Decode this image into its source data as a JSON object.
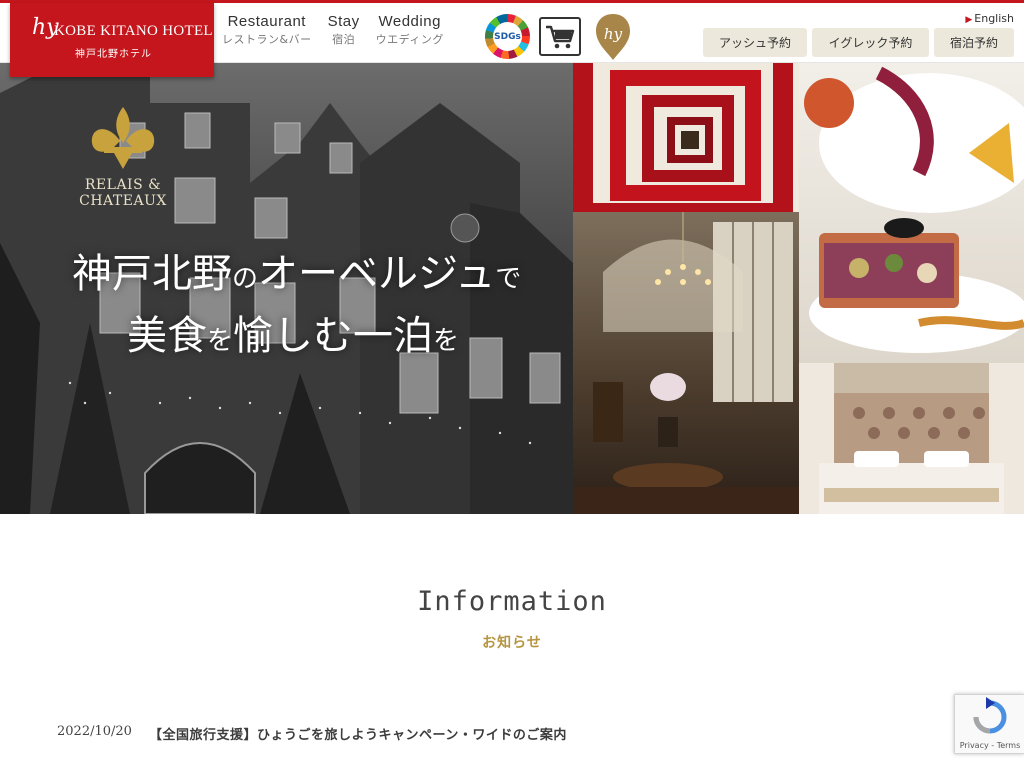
{
  "header": {
    "logo": {
      "mark": "hy",
      "name": "KOBE KITANO HOTEL",
      "sub": "神戸北野ホテル"
    },
    "nav": [
      {
        "en": "Restaurant",
        "ja": "レストラン&バー"
      },
      {
        "en": "Stay",
        "ja": "宿泊"
      },
      {
        "en": "Wedding",
        "ja": "ウエディング"
      }
    ],
    "sdgs_label": "SDGs",
    "lang_link": "English",
    "buttons": [
      {
        "label": "アッシュ予約"
      },
      {
        "label": "イグレック予約"
      },
      {
        "label": "宿泊予約"
      }
    ]
  },
  "hero": {
    "emblem_text_1": "RELAIS &",
    "emblem_text_2": "CHATEAUX",
    "copy_line1_a": "神戸北野",
    "copy_line1_b": "の",
    "copy_line1_c": "オーベルジュ",
    "copy_line1_d": "で",
    "copy_line2_a": "美食",
    "copy_line2_b": "を",
    "copy_line2_c": "愉しむ一泊",
    "copy_line2_d": "を"
  },
  "information": {
    "title": "Information",
    "subtitle": "お知らせ",
    "items": [
      {
        "date": "2022/10/20",
        "title": "【全国旅行支援】ひょうごを旅しようキャンペーン・ワイドのご案内"
      }
    ]
  },
  "recaptcha": {
    "links": "Privacy - Terms"
  }
}
